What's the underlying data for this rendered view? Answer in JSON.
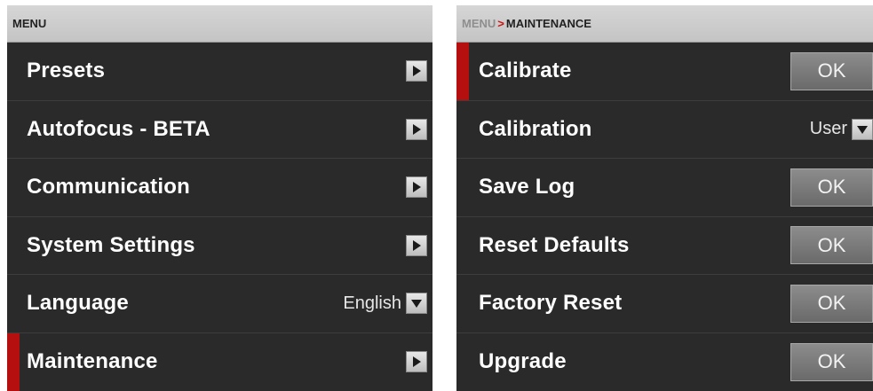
{
  "left_panel": {
    "header": "MENU",
    "items": [
      {
        "label": "Presets",
        "control": "arrow"
      },
      {
        "label": "Autofocus - BETA",
        "control": "arrow"
      },
      {
        "label": "Communication",
        "control": "arrow"
      },
      {
        "label": "System Settings",
        "control": "arrow"
      },
      {
        "label": "Language",
        "control": "dropdown",
        "value": "English"
      },
      {
        "label": "Maintenance",
        "control": "arrow",
        "selected": true
      }
    ]
  },
  "right_panel": {
    "breadcrumb": {
      "parent": "MENU",
      "separator": ">",
      "current": "MAINTENANCE"
    },
    "items": [
      {
        "label": "Calibrate",
        "control": "button",
        "button_label": "OK",
        "selected": true
      },
      {
        "label": "Calibration",
        "control": "dropdown",
        "value": "User"
      },
      {
        "label": "Save Log",
        "control": "button",
        "button_label": "OK"
      },
      {
        "label": "Reset Defaults",
        "control": "button",
        "button_label": "OK"
      },
      {
        "label": "Factory Reset",
        "control": "button",
        "button_label": "OK"
      },
      {
        "label": "Upgrade",
        "control": "button",
        "button_label": "OK"
      }
    ]
  },
  "colors": {
    "background": "#2a2a2a",
    "header": "#c8c8c8",
    "selection_accent": "#b50f0f",
    "breadcrumb_separator": "#cc1111"
  },
  "icons": {
    "submenu": "chevron-right-icon",
    "dropdown": "chevron-down-icon"
  }
}
